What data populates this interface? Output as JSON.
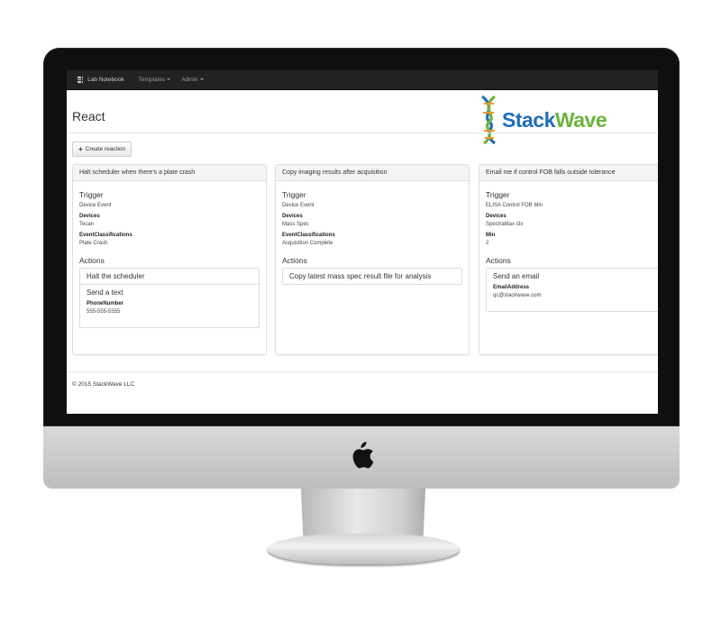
{
  "navbar": {
    "brand": "Lab Notebook",
    "items": [
      "Templates",
      "Admin"
    ]
  },
  "page": {
    "title": "React",
    "create_button": "Create reaction",
    "logo": {
      "part1": "Stack",
      "part2": "Wave"
    },
    "footer": "© 2015 StackWave LLC"
  },
  "colors": {
    "brand_blue": "#1f6fb7",
    "brand_green": "#6db33f",
    "navbar": "#222222"
  },
  "reactions": [
    {
      "name": "Halt scheduler when there's a plate crash",
      "trigger_label": "Trigger",
      "trigger": "Device Event",
      "fields": [
        {
          "key": "Devices",
          "value": "Tecan"
        },
        {
          "key": "EventClassifications",
          "value": "Plate Crash"
        }
      ],
      "actions_label": "Actions",
      "actions": [
        {
          "title": "Halt the scheduler"
        },
        {
          "title": "Send a text",
          "key": "PhoneNumber",
          "value": "555-555-5555"
        }
      ]
    },
    {
      "name": "Copy imaging results after acquisition",
      "trigger_label": "Trigger",
      "trigger": "Device Event",
      "fields": [
        {
          "key": "Devices",
          "value": "Mass Spec"
        },
        {
          "key": "EventClassifications",
          "value": "Acquisition Complete"
        }
      ],
      "actions_label": "Actions",
      "actions": [
        {
          "title": "Copy latest mass spec result file for analysis"
        }
      ]
    },
    {
      "name": "Email me if control FOB falls outside tolerance",
      "trigger_label": "Trigger",
      "trigger": "ELISA Control FOB Min",
      "fields": [
        {
          "key": "Devices",
          "value": "SpectraMax i3x"
        },
        {
          "key": "Min",
          "value": "2"
        }
      ],
      "actions_label": "Actions",
      "actions": [
        {
          "title": "Send an email",
          "key": "EmailAddress",
          "value": "qc@stackwave.com"
        }
      ]
    }
  ]
}
